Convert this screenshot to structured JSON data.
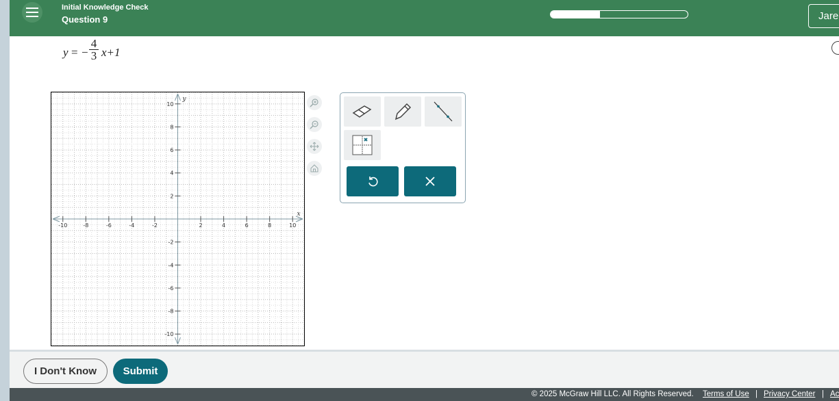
{
  "header": {
    "title": "Initial Knowledge Check",
    "question": "Question 9",
    "progress_fraction": 0.36,
    "user_label": "Jare"
  },
  "equation": {
    "lhs": "y",
    "eq": "=",
    "minus": "−",
    "numerator": "4",
    "denominator": "3",
    "rest": "x+1"
  },
  "graph": {
    "x_label": "x",
    "y_label": "y",
    "x_ticks": [
      "-10",
      "-8",
      "-6",
      "-4",
      "-2",
      "2",
      "4",
      "6",
      "8",
      "10"
    ],
    "y_ticks": [
      "10",
      "8",
      "6",
      "4",
      "2",
      "-2",
      "-4",
      "-6",
      "-8",
      "-10"
    ],
    "range": [
      -11,
      11
    ]
  },
  "side_tools": [
    "zoom-in-icon",
    "zoom-out-icon",
    "move-icon",
    "home-icon"
  ],
  "toolbox": {
    "tools": [
      "eraser-icon",
      "pencil-icon",
      "line-icon",
      "point-grid-icon"
    ],
    "actions": [
      "undo-icon",
      "close-icon"
    ]
  },
  "actions": {
    "dont_know": "I Don't Know",
    "submit": "Submit"
  },
  "footer": {
    "copyright": "© 2025 McGraw Hill LLC. All Rights Reserved.",
    "terms": "Terms of Use",
    "sep1": "|",
    "privacy": "Privacy Center",
    "sep2": "|",
    "access": "Ac"
  },
  "colors": {
    "header": "#3b8256",
    "accent": "#0d6a7a",
    "footer": "#4a5356"
  }
}
